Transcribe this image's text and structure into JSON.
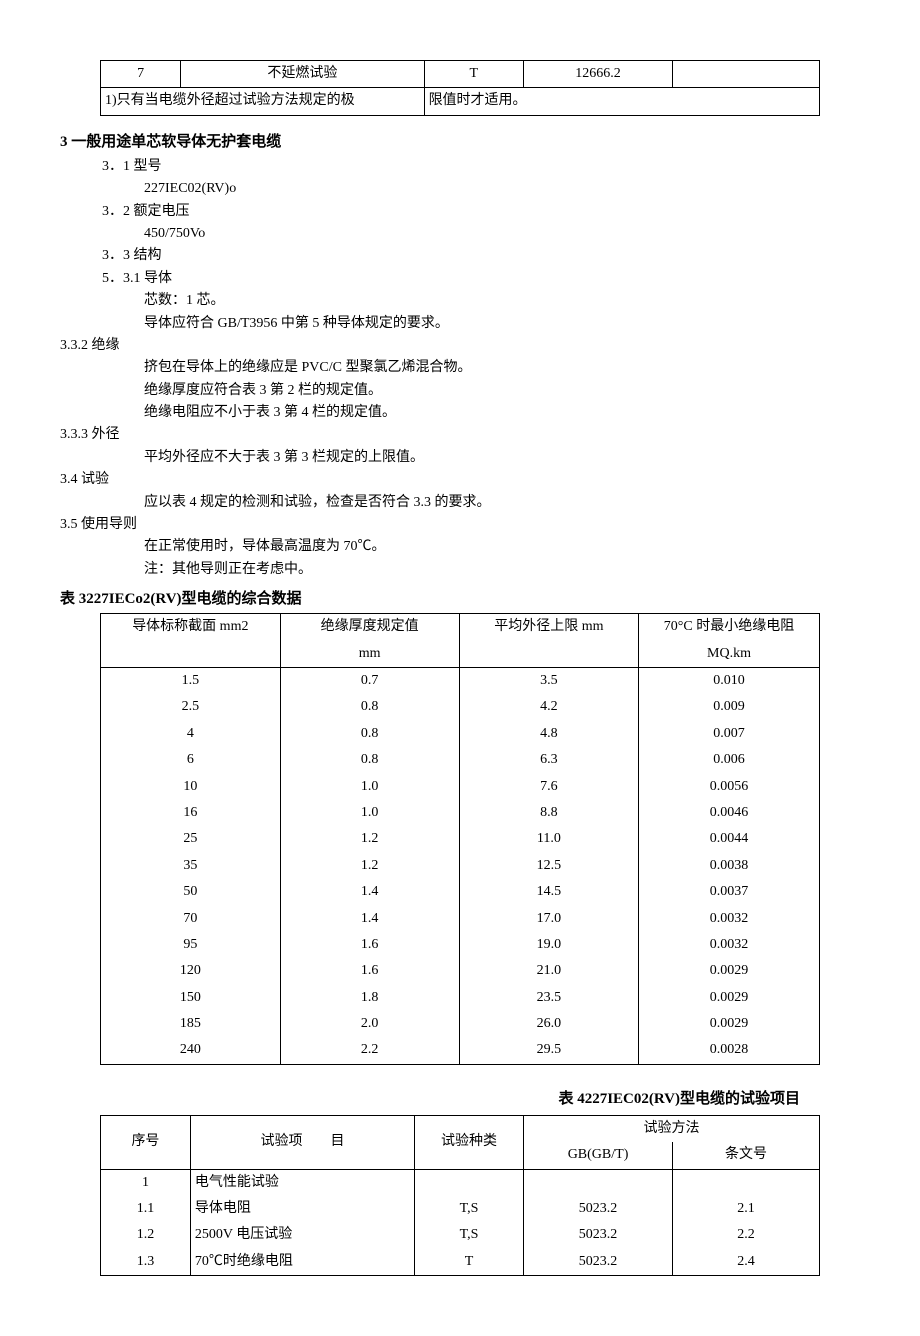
{
  "top_table": {
    "row": {
      "c0": "7",
      "c1": "不延燃试验",
      "c2": "T",
      "c3": "12666.2",
      "c4": ""
    },
    "note_left": "1)只有当电缆外径超过试验方法规定的极",
    "note_right": "限值时才适用。"
  },
  "section3": {
    "heading": "3 一般用途单芯软导体无护套电缆",
    "s31_num": "3．1 型号",
    "s31_val": "227IEC02(RV)o",
    "s32_num": "3．2 额定电压",
    "s32_val": "450/750Vo",
    "s33_num": "3．3 结构",
    "s331_num": "5．3.1 导体",
    "s331_l1": "芯数：1 芯。",
    "s331_l2": "导体应符合 GB/T3956 中第 5 种导体规定的要求。",
    "s332_num": "3.3.2 绝缘",
    "s332_l1": "挤包在导体上的绝缘应是 PVC/C 型聚氯乙烯混合物。",
    "s332_l2": "绝缘厚度应符合表 3 第 2 栏的规定值。",
    "s332_l3": "绝缘电阻应不小于表 3 第 4 栏的规定值。",
    "s333_num": "3.3.3 外径",
    "s333_l1": "平均外径应不大于表 3 第 3 栏规定的上限值。",
    "s34_num": "3.4 试验",
    "s34_l1": "应以表 4 规定的检测和试验，检查是否符合 3.3 的要求。",
    "s35_num": "3.5 使用导则",
    "s35_l1": "在正常使用时，导体最高温度为 70℃。",
    "s35_l2": "注：其他导则正在考虑中。"
  },
  "table3": {
    "caption": "表 3227IECo2(RV)型电缆的综合数据",
    "headers": {
      "h1": "导体标称截面 mm2",
      "h2": "绝缘厚度规定值",
      "h2u": "mm",
      "h3": "平均外径上限 mm",
      "h4": "70°C 时最小绝缘电阻",
      "h4u": "MQ.km"
    },
    "rows": [
      {
        "a": "1.5",
        "b": "0.7",
        "c": "3.5",
        "d": "0.010"
      },
      {
        "a": "2.5",
        "b": "0.8",
        "c": "4.2",
        "d": "0.009"
      },
      {
        "a": "4",
        "b": "0.8",
        "c": "4.8",
        "d": "0.007"
      },
      {
        "a": "6",
        "b": "0.8",
        "c": "6.3",
        "d": "0.006"
      },
      {
        "a": "10",
        "b": "1.0",
        "c": "7.6",
        "d": "0.0056"
      },
      {
        "a": "16",
        "b": "1.0",
        "c": "8.8",
        "d": "0.0046"
      },
      {
        "a": "25",
        "b": "1.2",
        "c": "11.0",
        "d": "0.0044"
      },
      {
        "a": "35",
        "b": "1.2",
        "c": "12.5",
        "d": "0.0038"
      },
      {
        "a": "50",
        "b": "1.4",
        "c": "14.5",
        "d": "0.0037"
      },
      {
        "a": "70",
        "b": "1.4",
        "c": "17.0",
        "d": "0.0032"
      },
      {
        "a": "95",
        "b": "1.6",
        "c": "19.0",
        "d": "0.0032"
      },
      {
        "a": "120",
        "b": "1.6",
        "c": "21.0",
        "d": "0.0029"
      },
      {
        "a": "150",
        "b": "1.8",
        "c": "23.5",
        "d": "0.0029"
      },
      {
        "a": "185",
        "b": "2.0",
        "c": "26.0",
        "d": "0.0029"
      },
      {
        "a": "240",
        "b": "2.2",
        "c": "29.5",
        "d": "0.0028"
      }
    ]
  },
  "table4": {
    "caption": "表 4227IEC02(RV)型电缆的试验项目",
    "headers": {
      "h1": "序号",
      "h2": "试验项　　目",
      "h3": "试验种类",
      "h4": "试验方法",
      "h4a": "GB(GB/T)",
      "h4b": "条文号"
    },
    "rows": [
      {
        "n": "1",
        "name": "电气性能试验",
        "type": "",
        "gb": "",
        "art": ""
      },
      {
        "n": "1.1",
        "name": "导体电阻",
        "type": "T,S",
        "gb": "5023.2",
        "art": "2.1"
      },
      {
        "n": "1.2",
        "name": "2500V 电压试验",
        "type": "T,S",
        "gb": "5023.2",
        "art": "2.2"
      },
      {
        "n": "1.3",
        "name": "70℃时绝缘电阻",
        "type": "T",
        "gb": "5023.2",
        "art": "2.4"
      }
    ]
  }
}
